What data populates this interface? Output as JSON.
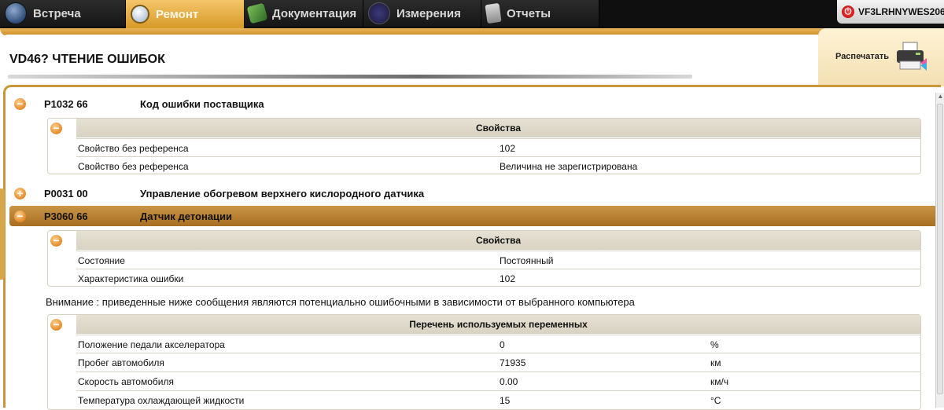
{
  "tabs": [
    {
      "label": "Встреча",
      "icon": "globe-icon",
      "active": false
    },
    {
      "label": "Ремонт",
      "icon": "magnifier-icon",
      "active": true
    },
    {
      "label": "Документация",
      "icon": "book-icon",
      "active": false
    },
    {
      "label": "Измерения",
      "icon": "waveform-icon",
      "active": false
    },
    {
      "label": "Отчеты",
      "icon": "document-icon",
      "active": false
    }
  ],
  "vin": "VF3LRHNYWES206",
  "page_title": "VD46?  ЧТЕНИЕ ОШИБОК",
  "print_label": "Распечатать",
  "colors": {
    "accent": "#d89a28",
    "selected_row": "#b07a2a",
    "toggle": "#e38a2a"
  },
  "faults": [
    {
      "code": "P1032 66",
      "description": "Код ошибки поставщика",
      "expanded": true,
      "properties_title": "Свойства",
      "properties": [
        {
          "name": "Свойство без референса",
          "value": "102"
        },
        {
          "name": "Свойство без референса",
          "value": "Величина не зарегистрирована"
        }
      ]
    },
    {
      "code": "P0031 00",
      "description": "Управление обогревом верхнего кислородного датчика",
      "expanded": false
    },
    {
      "code": "P3060 66",
      "description": "Датчик детонации",
      "expanded": true,
      "selected": true,
      "properties_title": "Свойства",
      "properties": [
        {
          "name": "Состояние",
          "value": "Постоянный"
        },
        {
          "name": "Характеристика ошибки",
          "value": "102"
        }
      ],
      "warning": "Внимание : приведенные ниже сообщения являются потенциально ошибочными в зависимости от выбранного компьютера",
      "variables_title": "Перечень используемых переменных",
      "variables": [
        {
          "name": "Положение педали акселератора",
          "value": "0",
          "unit": "%"
        },
        {
          "name": "Пробег автомобиля",
          "value": "71935",
          "unit": "км"
        },
        {
          "name": "Скорость автомобиля",
          "value": "0.00",
          "unit": "км/ч"
        },
        {
          "name": "Температура охлаждающей жидкости",
          "value": "15",
          "unit": "°C"
        }
      ]
    }
  ]
}
